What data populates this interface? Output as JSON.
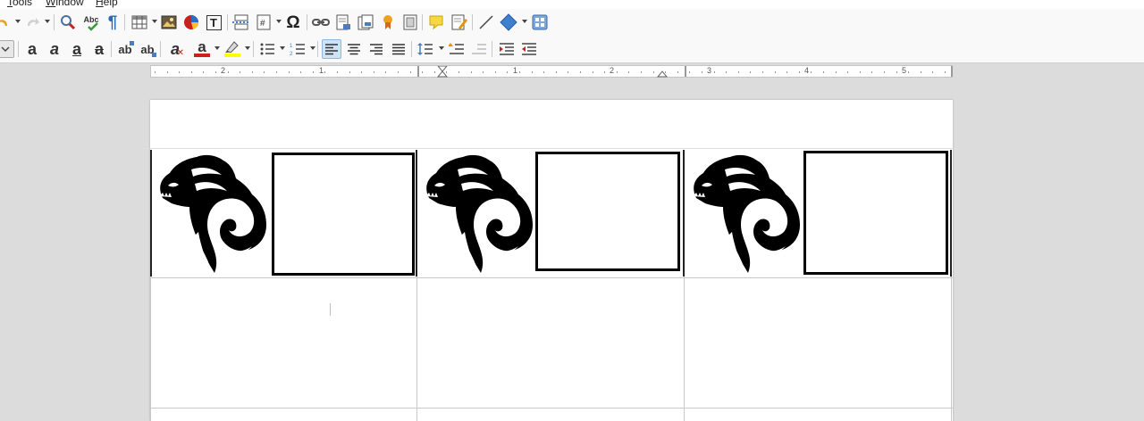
{
  "menubar": {
    "items": [
      {
        "accel": "T",
        "rest": "ools"
      },
      {
        "accel": "W",
        "rest": "indow"
      },
      {
        "accel": "H",
        "rest": "elp"
      }
    ]
  },
  "toolbar1": {
    "buttons": [
      "undo-icon",
      "redo-icon",
      "find-replace-icon",
      "spellcheck-icon",
      "formatting-marks-icon",
      "insert-table-icon",
      "insert-image-icon",
      "insert-chart-icon",
      "insert-textbox-icon",
      "insert-page-break-icon",
      "insert-field-icon",
      "special-character-icon",
      "hyperlink-icon",
      "footnote-icon",
      "endnote-icon",
      "bookmark-icon",
      "cross-reference-icon",
      "comment-icon",
      "track-changes-icon",
      "line-icon",
      "basic-shapes-icon",
      "draw-functions-icon"
    ],
    "glyphs": {
      "spellcheck": "Abc",
      "formatting_marks": "¶",
      "special_character": "Ω",
      "textbox": "T"
    }
  },
  "toolbar2": {
    "buttons": [
      "bold-icon",
      "italic-icon",
      "underline-icon",
      "strikethrough-icon",
      "superscript-icon",
      "subscript-icon",
      "clear-formatting-icon",
      "font-color-icon",
      "highlight-color-icon",
      "unordered-list-icon",
      "ordered-list-icon",
      "align-left-icon",
      "align-center-icon",
      "align-right-icon",
      "justify-icon",
      "line-spacing-icon",
      "increase-paragraph-spacing-icon",
      "decrease-paragraph-spacing-icon",
      "increase-indent-icon",
      "decrease-indent-icon"
    ],
    "glyphs": {
      "bold": "a",
      "italic": "a",
      "underline": "a",
      "strike": "a",
      "superscript": "ab",
      "subscript": "ab",
      "clear": "a",
      "font_color": "a"
    },
    "colors": {
      "font_color": "#c9211e",
      "highlight": "#ffff00",
      "active": "#cfe3f7"
    }
  },
  "ruler": {
    "labels": [
      "2",
      "1",
      "1",
      "2",
      "3",
      "4",
      "5"
    ]
  },
  "document": {
    "row1": [
      {
        "image": "dragon-head-logo",
        "frame": "empty-frame"
      },
      {
        "image": "dragon-head-logo",
        "frame": "empty-frame"
      },
      {
        "image": "dragon-head-logo",
        "frame": "empty-frame"
      }
    ]
  }
}
